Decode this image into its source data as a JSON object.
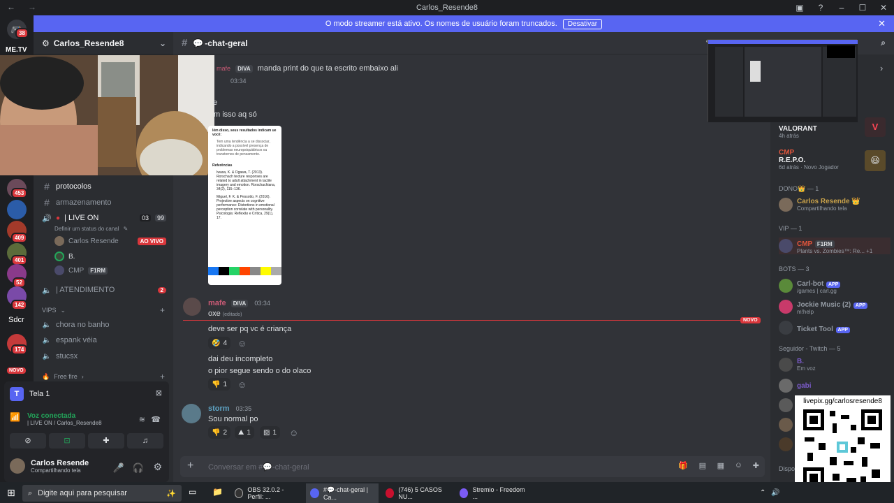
{
  "window": {
    "title": "Carlos_Resende8"
  },
  "banner": {
    "text": "O modo streamer está ativo. Os nomes de usuário foram truncados.",
    "button": "Desativar"
  },
  "rail": {
    "brand": "ME.TV",
    "badges": [
      "38",
      "453",
      "409",
      "401",
      "52",
      "142",
      "174"
    ],
    "text_item": "Sdcr",
    "novo": "NOVO"
  },
  "guild": {
    "name": "Carlos_Resende8"
  },
  "channels": {
    "protocolos": "protocolos",
    "armazenamento": "armazenamento",
    "live_on": "| LIVE ON",
    "live_count_a": "03",
    "live_count_b": "99",
    "status_hint": "Definir um status do canal",
    "voice_users": [
      {
        "name": "Carlos Resende",
        "live": "AO VIVO"
      },
      {
        "name": "B."
      },
      {
        "name": "CMP",
        "tag": "F1RM"
      }
    ],
    "atendimento": "| ATENDIMENTO",
    "atendimento_badge": "2",
    "vips_category": "VIPS",
    "vips": [
      "chora no banho",
      "espank véia",
      "stucsx"
    ],
    "freefire_category": "Free fire"
  },
  "voice_panel": {
    "stream_title": "Tela 1",
    "connected": "Voz conectada",
    "connected_sub": "| LIVE ON / Carlos_Resende8"
  },
  "user_panel": {
    "name": "Carlos Resende",
    "status": "Compartilhando tela"
  },
  "chat": {
    "channel": "-chat-geral",
    "top_line": {
      "author": "mafe",
      "tag": "DIVA",
      "text": "manda print do que ta escrito embaixo ali"
    },
    "storm_time": "03:34",
    "partial_line_1": "e",
    "partial_line_2": "m isso aq só",
    "shot_heading": "lém disso, seus resultados indicam ue você:",
    "shot_bullet": "Tem uma tendência a se dissociar, indicando a possível presença de problemas neuropsiquiátricos ou transtornos de pensamento.",
    "shot_refs_title": "Referências",
    "shot_ref_1": "Iwasa, K. & Ogawa, T. (2013). Rorschach texture responses are related to adult attachment in tactile imagery and emotion. Rorschachiana, 34(2), 115–136.",
    "shot_ref_2": "Miguel, F. K. & Pessotto, F. (2016). Projective aspects on cognitive performance: Distortions in emotional perception correlate with personality. Psicologia: Reflexão e Crítica, 29(1), 17.",
    "mafe_msg": {
      "author": "mafe",
      "tag": "DIVA",
      "time": "03:34",
      "text": "oxe",
      "edited": "(editado)"
    },
    "novo": "NOVO",
    "line_1": "deve ser pq vc é criança",
    "reaction_1": "4",
    "line_2": "dai deu incompleto",
    "line_3": "o pior segue sendo o do olaco",
    "reaction_2": "1",
    "storm_msg": {
      "author": "storm",
      "time": "03:35",
      "text": "Sou normal po"
    },
    "reactions_3": [
      "2",
      "1",
      "1"
    ],
    "composer_placeholder": "Conversar em #💬-chat-geral"
  },
  "members": {
    "activity_1": {
      "title": "VALORANT",
      "sub": "4h atrás"
    },
    "activity_2": {
      "name": "CMP",
      "title": "R.E.P.O.",
      "sub": "6d atrás",
      "extra": "Novo Jogador"
    },
    "dono_header": "DONO👑 — 1",
    "dono": {
      "name": "Carlos Resende 👑",
      "status": "Compartilhando tela"
    },
    "vip_header": "VIP — 1",
    "vip": {
      "name": "CMP",
      "tag": "F1RM",
      "status": "Plants vs. Zombies™: Re...",
      "extra": "+1"
    },
    "bots_header": "BOTS — 3",
    "bots": [
      {
        "name": "Carl-bot",
        "status": "/games | carl.gg"
      },
      {
        "name": "Jockie Music (2)",
        "status": "m!help"
      },
      {
        "name": "Ticket Tool",
        "status": ""
      }
    ],
    "app_label": "APP",
    "twitch_header": "Seguidor - Twitch — 5",
    "twitch": [
      {
        "name": "B.",
        "status": "Em voz"
      },
      {
        "name": "gabi",
        "status": ""
      }
    ],
    "dispo": "Dispo"
  },
  "qr": {
    "url": "livepix.gg/carlosresende8"
  },
  "taskbar": {
    "search_placeholder": "Digite aqui para pesquisar",
    "apps": [
      "OBS 32.0.2 - Perfil: ...",
      "#💬-chat-geral | Ca...",
      "(746) 5 CASOS NU...",
      "Stremio - Freedom ..."
    ]
  },
  "colors": {
    "accent": "#5865f2",
    "danger": "#da373c",
    "green": "#23a55a",
    "mafe": "#c85a75",
    "storm": "#5ea3c4",
    "cmp": "#e0553c"
  }
}
